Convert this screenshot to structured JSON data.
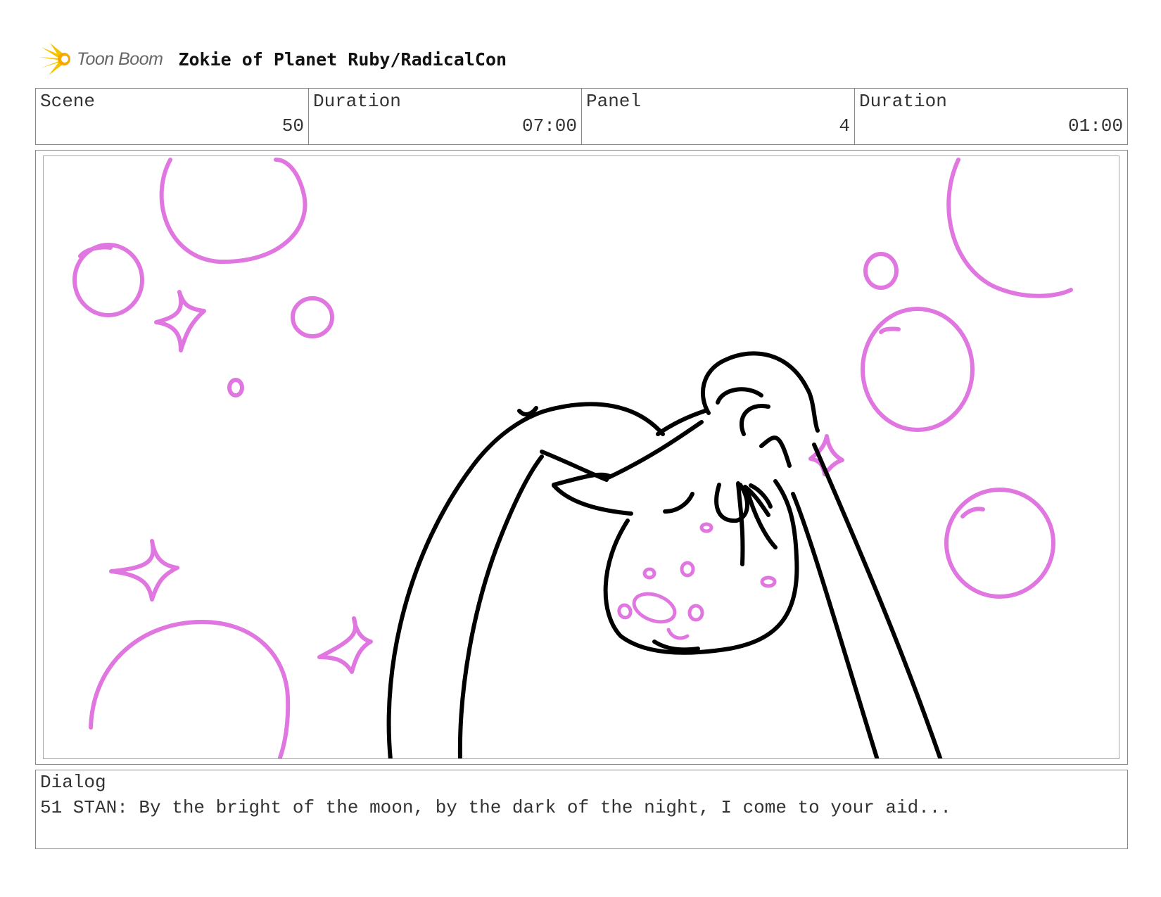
{
  "header": {
    "logo_text": "Toon Boom",
    "project_title": "Zokie of Planet Ruby/RadicalCon"
  },
  "info": {
    "scene_label": "Scene",
    "scene_value": "50",
    "scene_duration_label": "Duration",
    "scene_duration_value": "07:00",
    "panel_label": "Panel",
    "panel_value": "4",
    "panel_duration_label": "Duration",
    "panel_duration_value": "01:00"
  },
  "sketch": {
    "colors": {
      "line": "#000000",
      "sparkle": "#e077e0",
      "logo": "#f5c400"
    },
    "icon": "storyboard-sketch"
  },
  "dialog": {
    "label": "Dialog",
    "text": "51 STAN: By the bright of the moon, by the dark of the night, I come to your aid..."
  }
}
